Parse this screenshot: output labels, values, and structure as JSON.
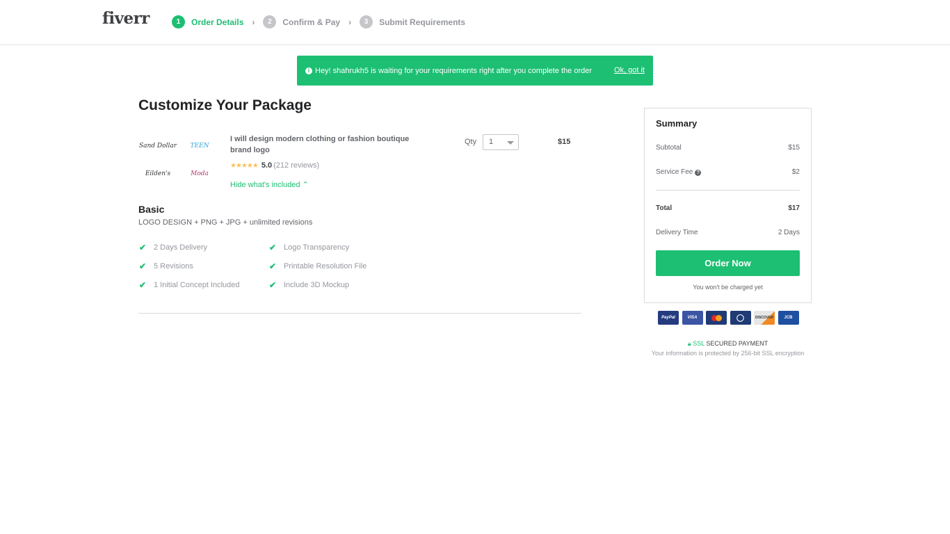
{
  "header": {
    "logo": "fiverr",
    "steps": [
      {
        "num": "1",
        "label": "Order Details",
        "active": true
      },
      {
        "num": "2",
        "label": "Confirm & Pay",
        "active": false
      },
      {
        "num": "3",
        "label": "Submit Requirements",
        "active": false
      }
    ],
    "chevron": "›"
  },
  "banner": {
    "icon": "info-icon",
    "text": "Hey! shahrukh5 is waiting for your requirements right after you complete the order",
    "dismiss": "Ok, got it"
  },
  "main": {
    "title": "Customize Your Package",
    "gig": {
      "thumbnails": [
        "Sand Dollar",
        "TEEN",
        "Eilden's",
        "Moda"
      ],
      "title": "I will design modern clothing or fashion boutique brand logo",
      "stars": "★★★★★",
      "rating": "5.0",
      "reviews": "(212 reviews)",
      "toggle_label": "Hide what's included ⌃",
      "qty_label": "Qty",
      "qty_value": "1",
      "price": "$15"
    },
    "package": {
      "name": "Basic",
      "description": "LOGO DESIGN + PNG + JPG + unlimited revisions",
      "features": [
        "2 Days Delivery",
        "Logo Transparency",
        "5 Revisions",
        "Printable Resolution File",
        "1 Initial Concept Included",
        "Include 3D Mockup"
      ]
    }
  },
  "summary": {
    "title": "Summary",
    "subtotal_label": "Subtotal",
    "subtotal": "$15",
    "fee_label": "Service Fee",
    "fee": "$2",
    "total_label": "Total",
    "total": "$17",
    "delivery_label": "Delivery Time",
    "delivery": "2 Days",
    "order_button": "Order Now",
    "note": "You won't be charged yet"
  },
  "payments": {
    "methods": [
      {
        "name": "PayPal",
        "color": "#253b80"
      },
      {
        "name": "VISA",
        "color": "#3b54a4"
      },
      {
        "name": "MC",
        "color": "#1f3b75"
      },
      {
        "name": "D",
        "color": "#1f3b75"
      },
      {
        "name": "DISCOVER",
        "color": "#e6e6e6"
      },
      {
        "name": "JCB",
        "color": "#1f4fa0"
      }
    ],
    "ssl_label": "SSL",
    "ssl_text": "SECURED PAYMENT",
    "ssl_sub": "Your information is protected by 256-bit SSL encryption"
  },
  "colors": {
    "brand": "#1dbf73",
    "star": "#ffbe5b"
  }
}
